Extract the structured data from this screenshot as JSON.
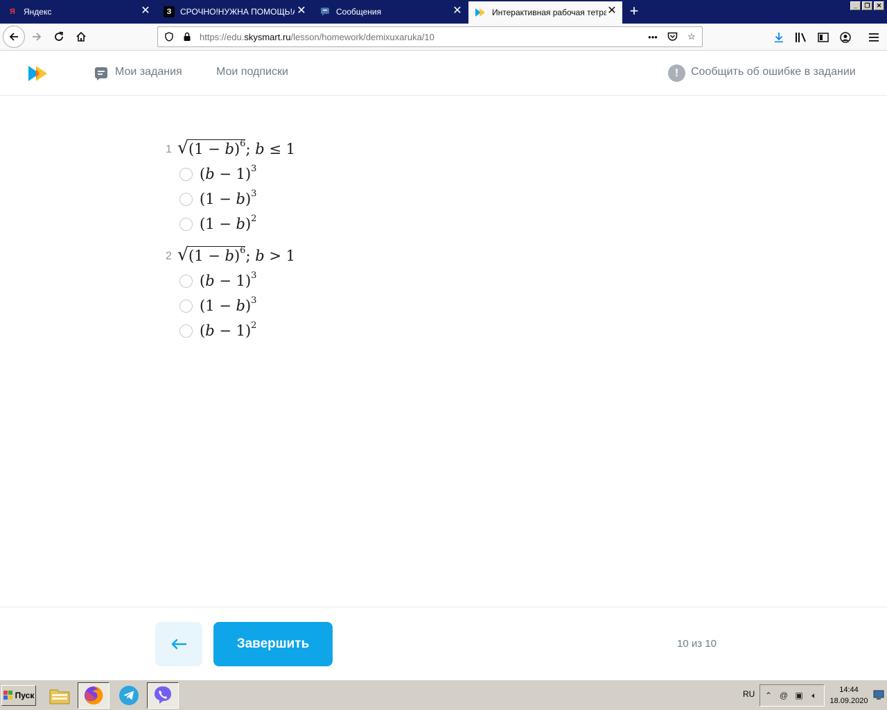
{
  "browser": {
    "tabs": [
      {
        "title": "Яндекс",
        "favicon_char": "Я",
        "favicon_color": "#ff3333",
        "active": false
      },
      {
        "title": "СРОЧНО!НУЖНА ПОМОЩЬ!АЛГ",
        "favicon_char": "З",
        "favicon_color": "#000000",
        "active": false
      },
      {
        "title": "Сообщения",
        "favicon_char": "",
        "favicon_color": "#4a76a8",
        "active": false
      },
      {
        "title": "Интерактивная рабочая тетрад",
        "favicon_char": "",
        "favicon_color": "#0ea5e9",
        "active": true
      }
    ],
    "tab_close_glyph": "✕",
    "new_tab_glyph": "+",
    "url_prefix": "https://edu.",
    "url_domain": "skysmart.ru",
    "url_path": "/lesson/homework/demixuxaruka/10"
  },
  "site_header": {
    "my_tasks_label": "Мои задания",
    "my_subscriptions_label": "Мои подписки",
    "report_error_label": "Сообщить об ошибке в задании"
  },
  "questions": [
    {
      "number": "1",
      "radicand_base": "(1 − ",
      "radicand_var": "b",
      "radicand_close": ")",
      "radicand_exp": "6",
      "condition_sep": "; ",
      "condition_var": "b",
      "condition_rel": " ≤ 1",
      "options": [
        {
          "open": "(",
          "first": "b",
          "middle": " − 1)",
          "exp": "3",
          "first_is_var": true
        },
        {
          "open": "(1 − ",
          "first": "b",
          "middle": ")",
          "exp": "3",
          "first_is_var": true
        },
        {
          "open": "(1 − ",
          "first": "b",
          "middle": ")",
          "exp": "2",
          "first_is_var": true
        }
      ]
    },
    {
      "number": "2",
      "radicand_base": "(1 − ",
      "radicand_var": "b",
      "radicand_close": ")",
      "radicand_exp": "6",
      "condition_sep": "; ",
      "condition_var": "b",
      "condition_rel": " > 1",
      "options": [
        {
          "open": "(",
          "first": "b",
          "middle": " − 1)",
          "exp": "3",
          "first_is_var": true
        },
        {
          "open": "(1 − ",
          "first": "b",
          "middle": ")",
          "exp": "3",
          "first_is_var": true
        },
        {
          "open": "(",
          "first": "b",
          "middle": " − 1)",
          "exp": "2",
          "first_is_var": true
        }
      ]
    }
  ],
  "footer": {
    "finish_label": "Завершить",
    "progress_text": "10 из 10"
  },
  "taskbar": {
    "start_label": "Пуск",
    "language": "RU",
    "time": "14:44",
    "date": "18.09.2020"
  },
  "colors": {
    "accent": "#0ea5e9",
    "back_button_bg": "#e8f6fc",
    "tab_strip": "#0f1d66"
  }
}
